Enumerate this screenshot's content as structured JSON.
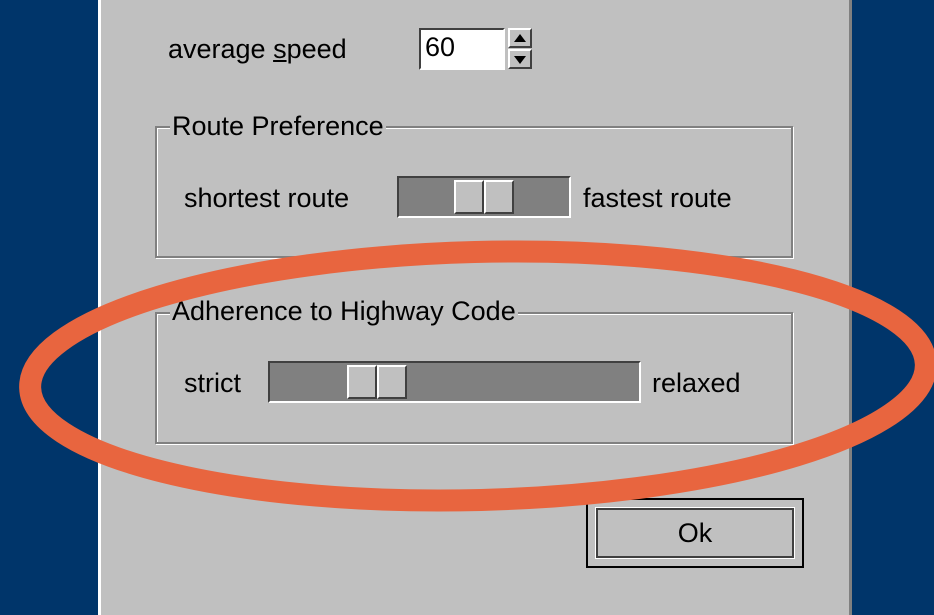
{
  "speed": {
    "label": "average speed",
    "label_prefix": "average ",
    "label_mnemonic": "s",
    "label_suffix": "peed",
    "value": "60"
  },
  "route_preference": {
    "title": "Route Preference",
    "left_label": "shortest route",
    "right_label": "fastest route",
    "slider_value_fraction": 0.5
  },
  "highway_code": {
    "title": "Adherence to Highway Code",
    "left_label": "strict",
    "right_label": "relaxed",
    "slider_value_fraction": 0.25
  },
  "ok_label": "Ok",
  "colors": {
    "background": "#00356a",
    "dialog": "#c0c0c0",
    "track": "#808080",
    "highlight": "#e8653f"
  },
  "icons": {
    "spin_up": "up-triangle-icon",
    "spin_down": "down-triangle-icon"
  }
}
